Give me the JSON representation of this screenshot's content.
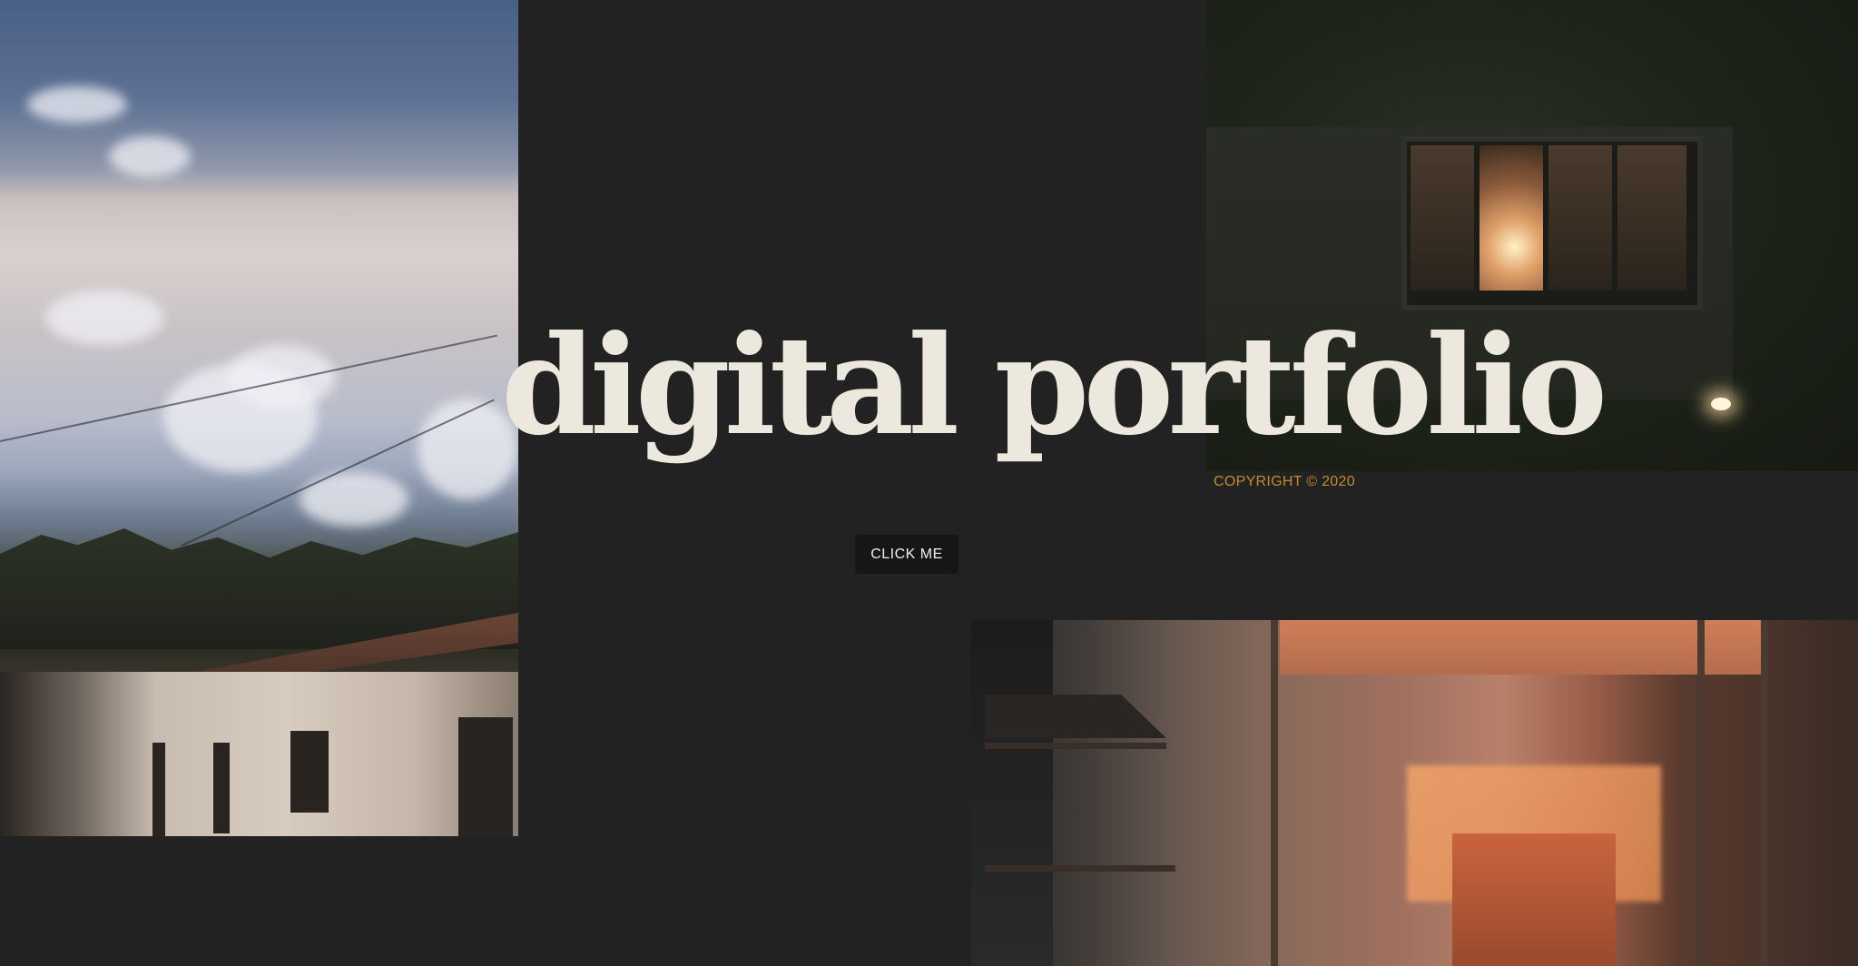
{
  "hero": {
    "title": "digital portfolio",
    "copyright": "COPYRIGHT © 2020",
    "cta_label": "CLICK ME"
  },
  "images": [
    {
      "name": "sky-mountains-houses-photo"
    },
    {
      "name": "night-window-photo"
    },
    {
      "name": "sunlit-interior-photo"
    }
  ],
  "colors": {
    "background": "#222222",
    "title": "#ece8de",
    "copyright": "#c58b2a",
    "button_bg": "#161616",
    "button_text": "#f2f2f2"
  }
}
